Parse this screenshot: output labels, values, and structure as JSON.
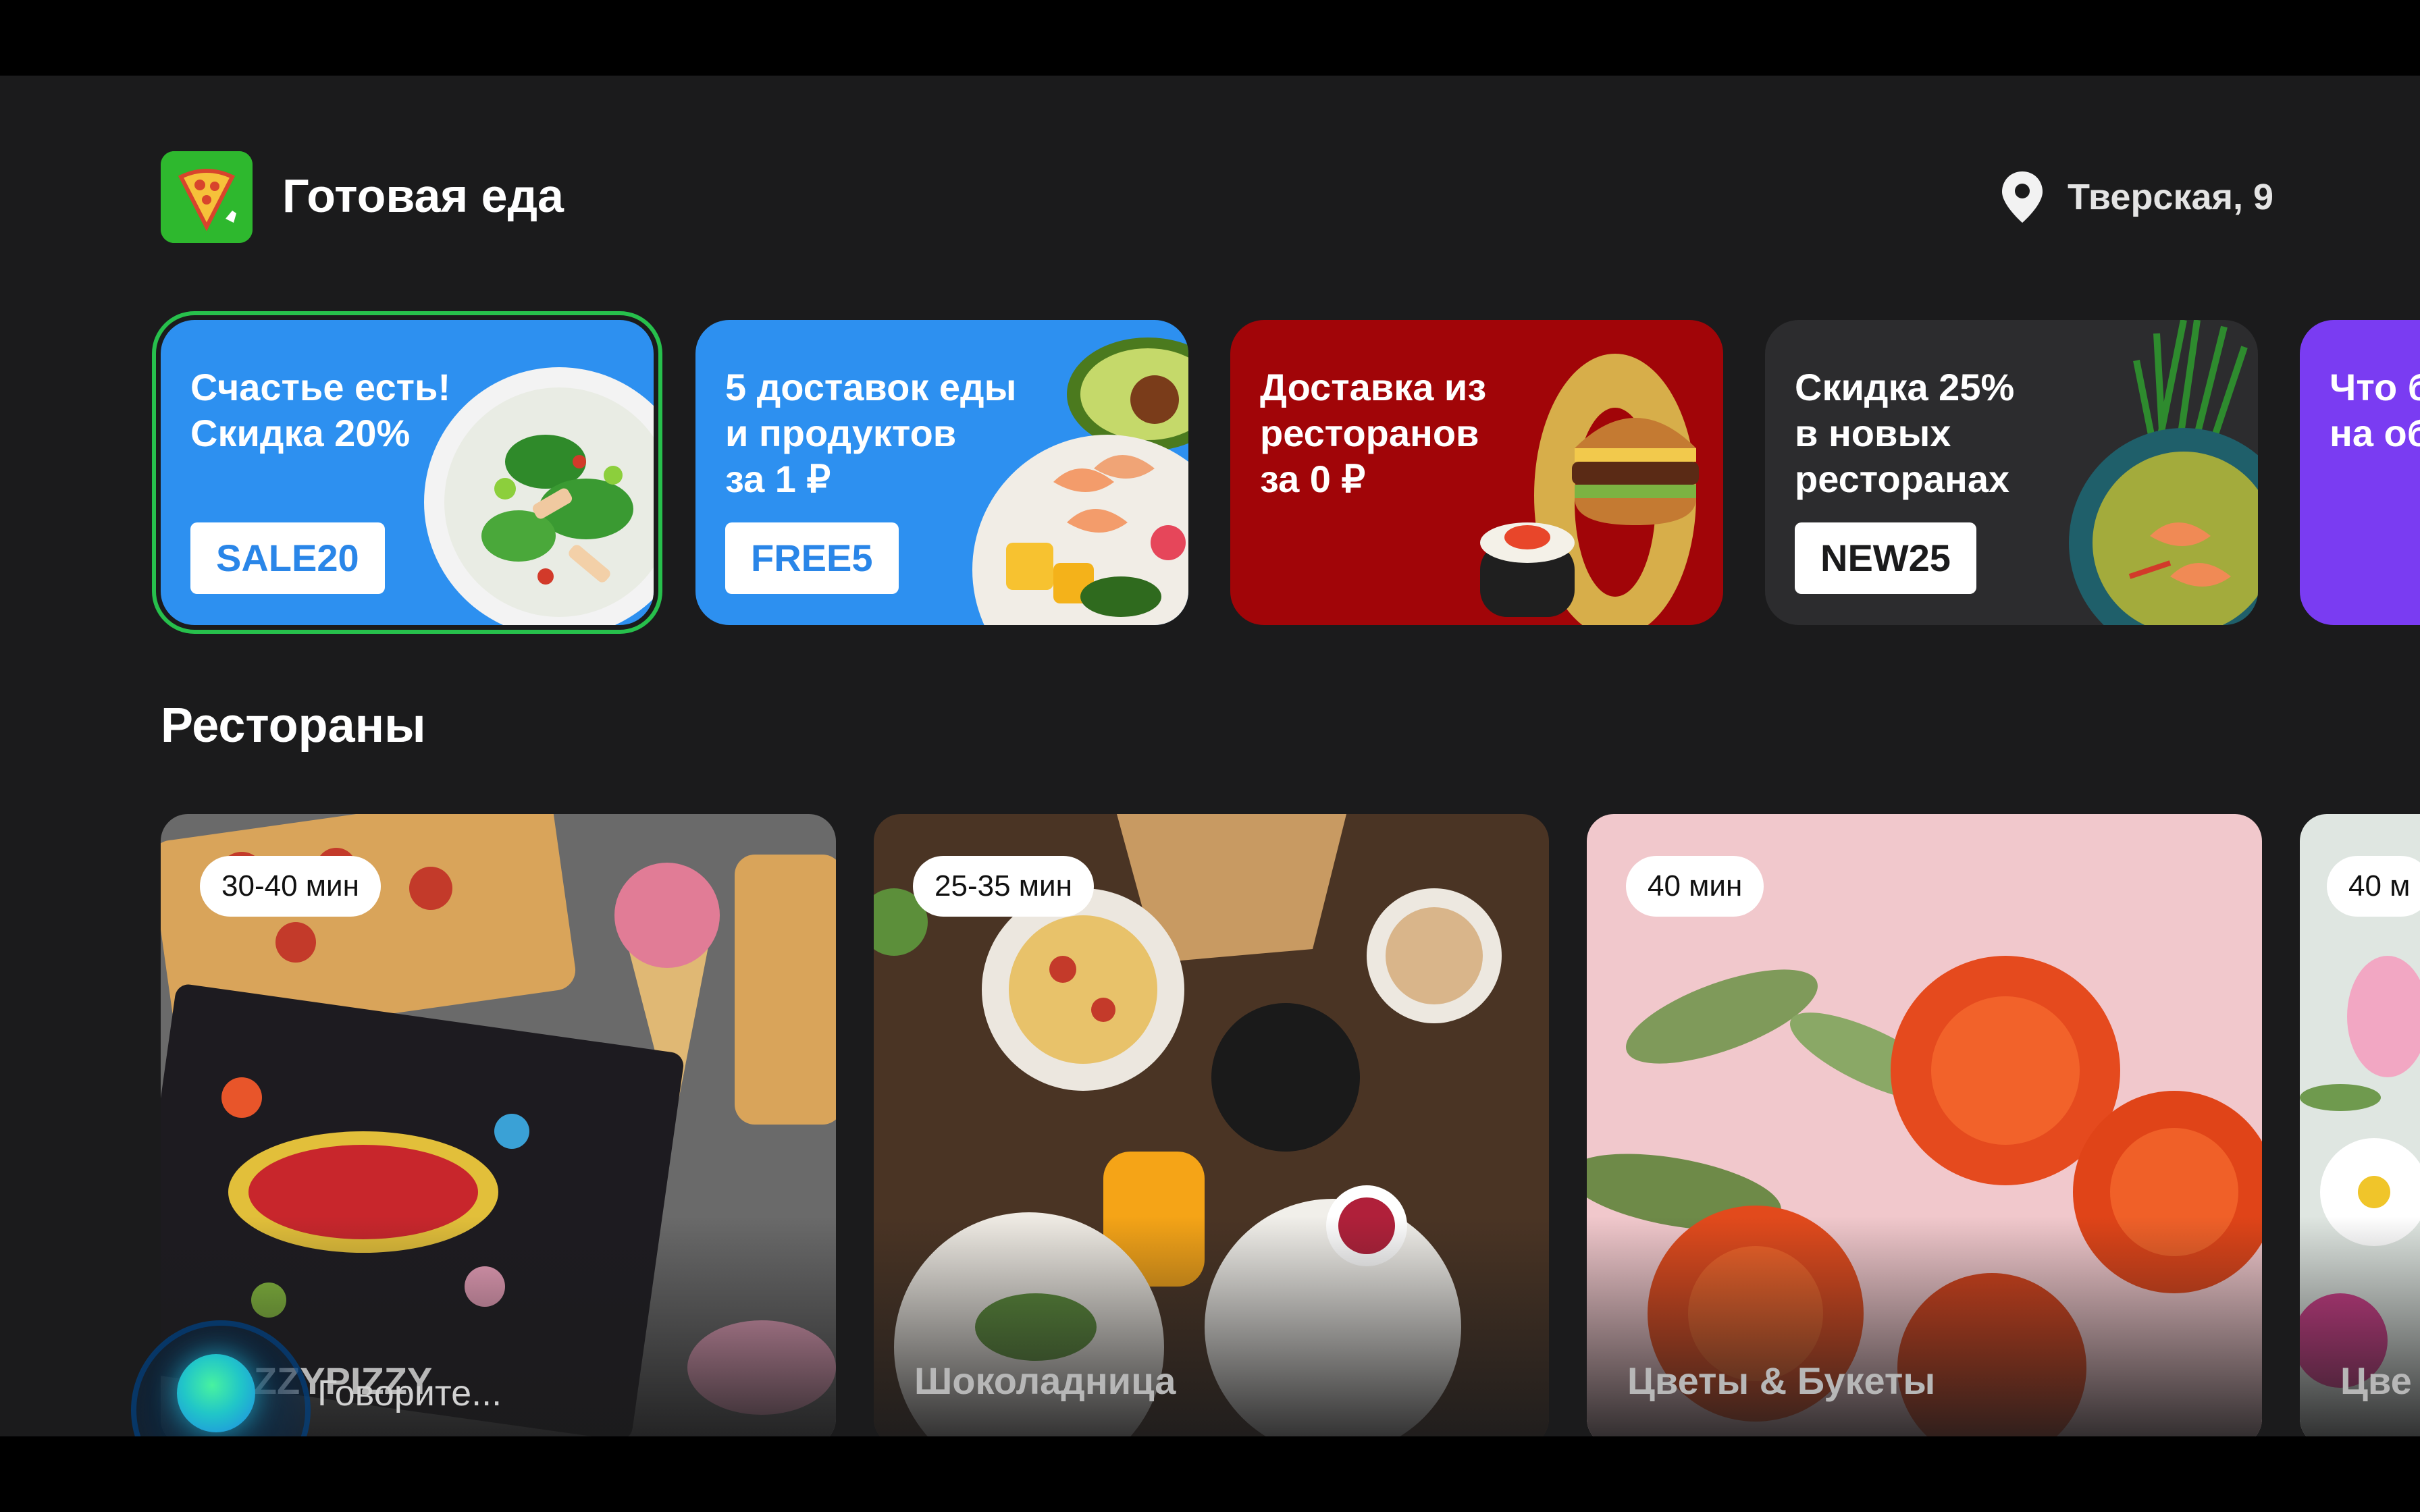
{
  "header": {
    "app_title": "Готовая еда",
    "location": "Тверская, 9"
  },
  "promos": [
    {
      "line1": "Счастье есть!",
      "line2": "Скидка 20%",
      "line3": "",
      "code": "SALE20",
      "code_color": "#2a86e8",
      "bg": "#2d90f0"
    },
    {
      "line1": "5 доставок еды",
      "line2": "и продуктов",
      "line3": "за 1 ₽",
      "code": "FREE5",
      "code_color": "#2a86e8",
      "bg": "#2d90f0"
    },
    {
      "line1": "Доставка из",
      "line2": "ресторанов",
      "line3": "за 0 ₽",
      "code": "",
      "bg": "#a10508"
    },
    {
      "line1": "Скидка 25%",
      "line2": "в новых",
      "line3": "ресторанах",
      "code": "NEW25",
      "code_color": "#1b1b1c",
      "bg": "#2c2c2e"
    },
    {
      "line1": "Что б",
      "line2": "на об",
      "line3": "",
      "code": "",
      "bg": "#7a3cf2"
    }
  ],
  "restaurants_section": {
    "title": "Рестораны"
  },
  "restaurants": [
    {
      "name": "EAZZYPIZZY",
      "time": "30-40 мин"
    },
    {
      "name": "Шоколадница",
      "time": "25-35 мин"
    },
    {
      "name": "Цветы & Букеты",
      "time": "40 мин"
    },
    {
      "name": "Цве",
      "time": "40 м"
    }
  ],
  "voice": {
    "prompt": "Говорите..."
  },
  "colors": {
    "background": "#1b1b1c",
    "focus_ring": "#27c04c",
    "logo_green": "#2eb82e"
  }
}
